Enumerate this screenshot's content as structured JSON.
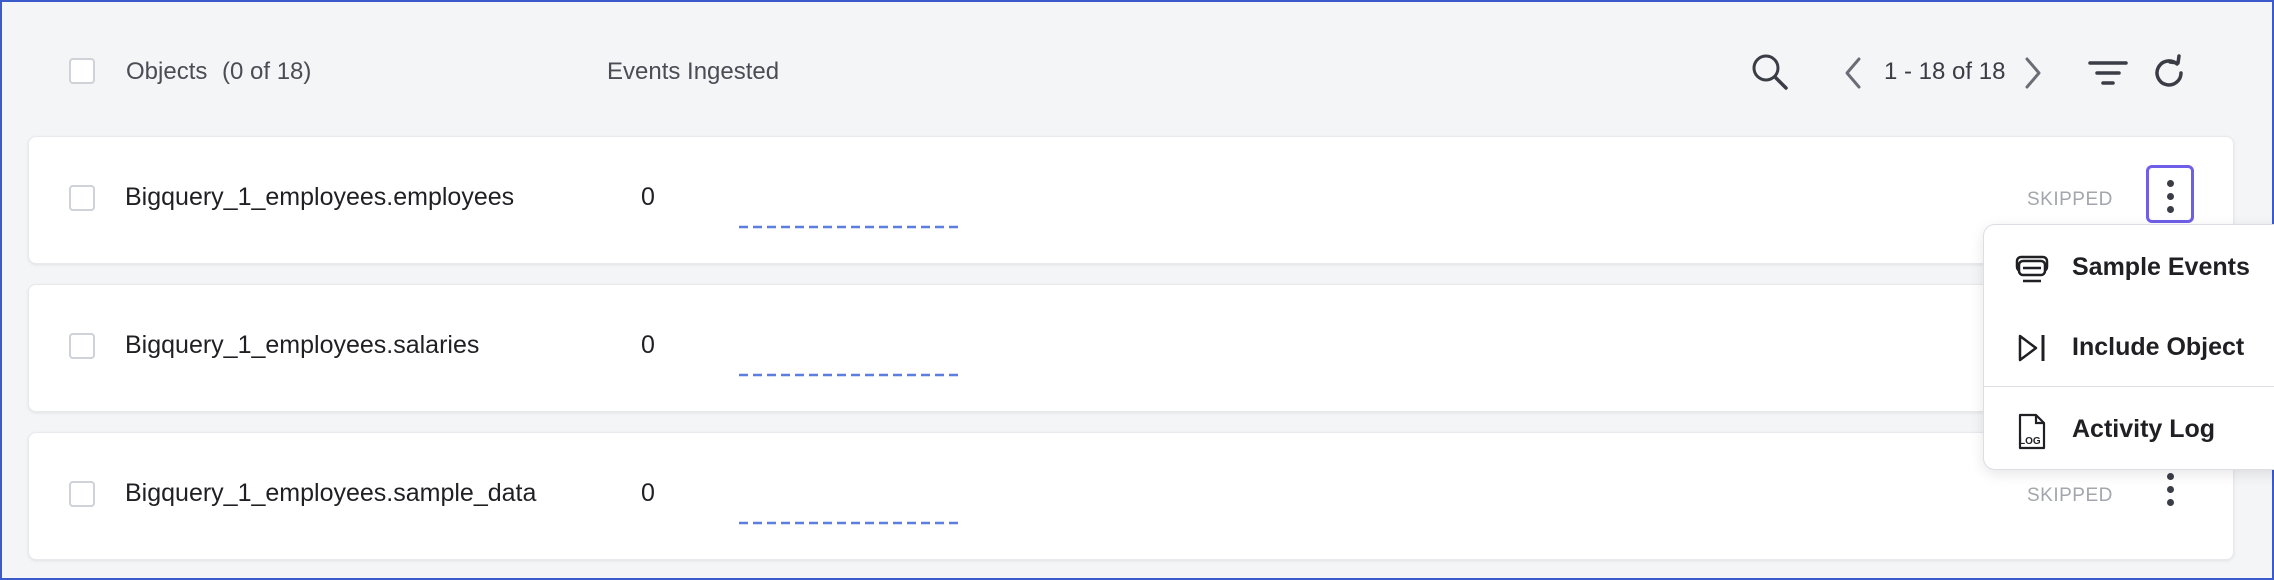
{
  "header": {
    "objects_label": "Objects",
    "objects_count": "(0 of 18)",
    "events_label": "Events Ingested",
    "pagination": "1 - 18 of 18"
  },
  "rows": [
    {
      "name": "Bigquery_1_employees.employees",
      "count": "0",
      "status": "SKIPPED"
    },
    {
      "name": "Bigquery_1_employees.salaries",
      "count": "0",
      "status": ""
    },
    {
      "name": "Bigquery_1_employees.sample_data",
      "count": "0",
      "status": "SKIPPED"
    }
  ],
  "menu": {
    "items": [
      {
        "label": "Sample Events",
        "icon": "sample-events-icon"
      },
      {
        "label": "Include Object",
        "icon": "include-object-icon"
      },
      {
        "label": "Activity Log",
        "icon": "log-icon"
      }
    ]
  },
  "colors": {
    "accent": "#6f5fe8",
    "sparkline": "#5b7fe0",
    "frame": "#3b5bcc"
  }
}
